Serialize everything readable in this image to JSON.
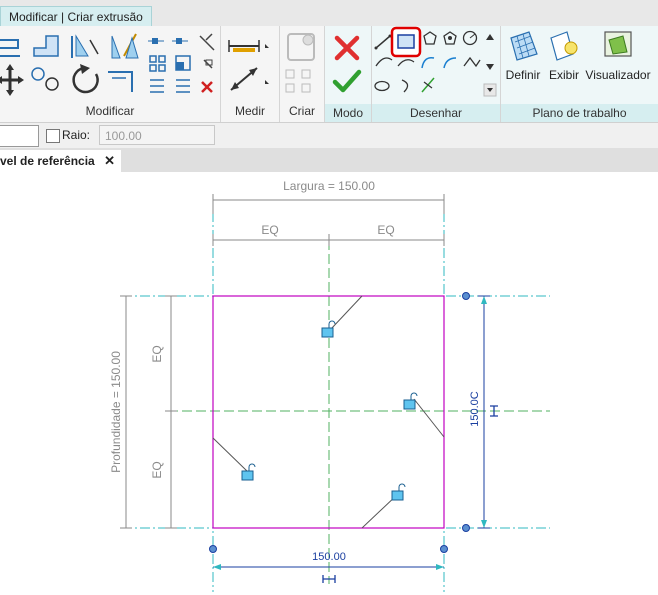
{
  "context_tab": {
    "label": "Modificar | Criar extrusão"
  },
  "panels": {
    "modify": "Modificar",
    "measure": "Medir",
    "create": "Criar",
    "mode": "Modo",
    "draw": "Desenhar",
    "workplane": "Plano de trabalho"
  },
  "workplane_tools": {
    "set": "Definir",
    "show": "Exibir",
    "viewer": "Visualizador"
  },
  "options_bar": {
    "radius_label": "Raio:",
    "radius_value": "100.00"
  },
  "view_tab": {
    "label": "vel de referência"
  },
  "drawing": {
    "width_label": "Largura = 150.00",
    "depth_label": "Profundidade = 150.00",
    "eq_label": "EQ",
    "bottom_dim": "150.00",
    "right_dim": "150.0C"
  },
  "colors": {
    "context_tab": "#d6eef0",
    "sketch_line": "#c000c0",
    "reference_plane": "#00a0a0",
    "dimension_text": "#1a3fa0",
    "highlight": "#e00000"
  }
}
